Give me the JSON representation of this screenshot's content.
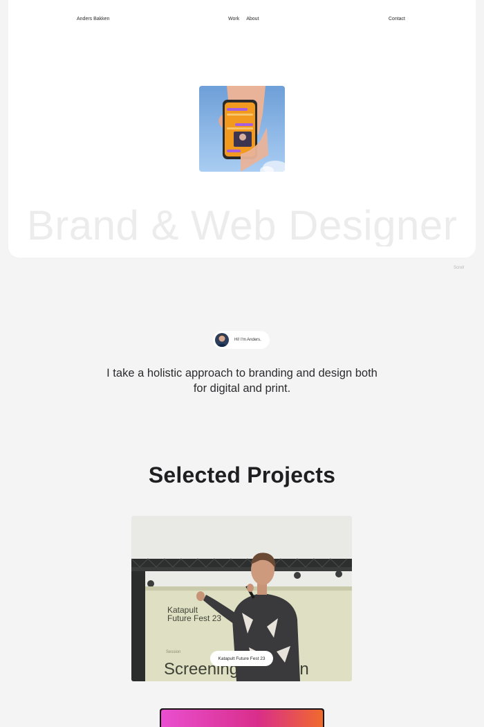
{
  "nav": {
    "brand": "Anders Bakken",
    "links": [
      "Work",
      "About"
    ],
    "contact": "Contact"
  },
  "hero": {
    "title": "Brand & Web Designer",
    "scroll_hint": "Scroll"
  },
  "intro": {
    "chip_text": "Hi! I'm Anders.",
    "statement": "I take a holistic approach to branding and design both for digital and print."
  },
  "projects_section": {
    "title": "Selected Projects",
    "items": [
      {
        "label": "Katapult Future Fest 23",
        "sign_line1": "Katapult",
        "sign_line2": "Future Fest 23",
        "sign_small": "Session",
        "sign_big": "Screening",
        "sign_big_tail": "an"
      }
    ]
  },
  "colors": {
    "background": "#f4f4f5",
    "card": "#ffffff",
    "hero_title": "#ececec",
    "sky": "#8fb9e6",
    "phone_screen": "#f29a1f",
    "purple": "#a55ee0"
  }
}
